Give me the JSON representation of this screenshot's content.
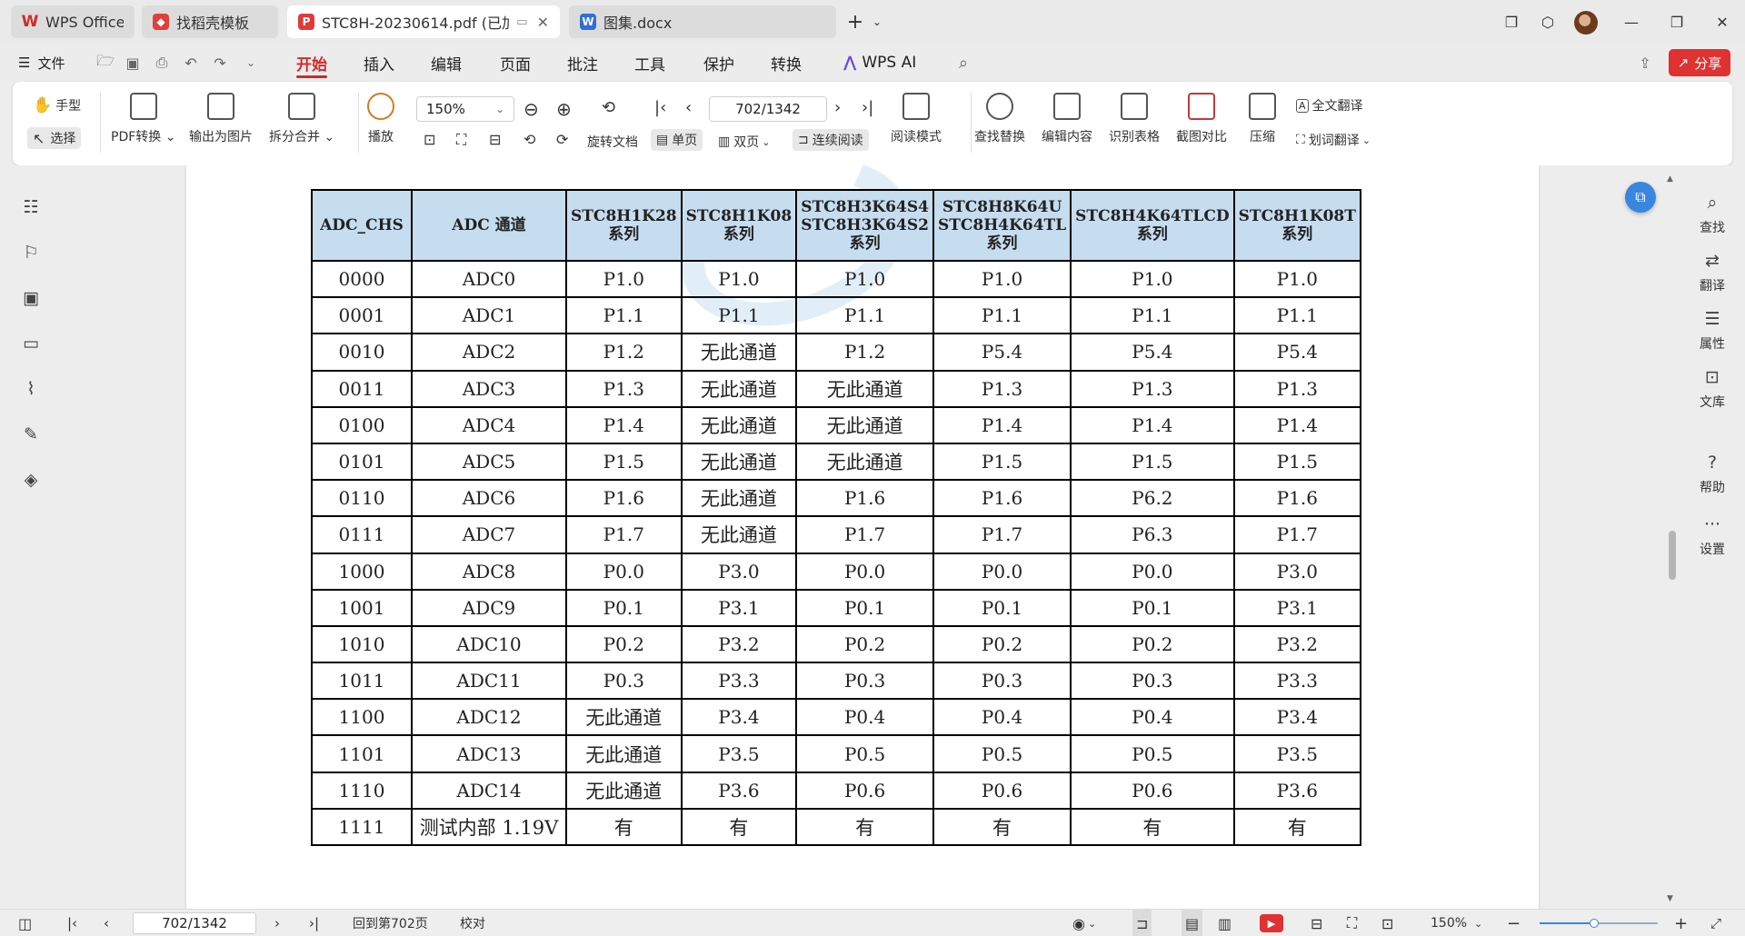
{
  "tabs": [
    {
      "label": "WPS Office",
      "icon": "wps-logo-icon"
    },
    {
      "label": "找稻壳模板",
      "icon": "docer-icon"
    },
    {
      "label": "STC8H-20230614.pdf (已加",
      "icon": "pdf-icon"
    },
    {
      "label": "图集.docx",
      "icon": "word-icon"
    }
  ],
  "menu": {
    "file": "文件",
    "items": [
      "开始",
      "插入",
      "编辑",
      "页面",
      "批注",
      "工具",
      "保护",
      "转换"
    ],
    "wps_ai": "WPS AI",
    "share": "分享"
  },
  "ribbon": {
    "hand": "手型",
    "select": "选择",
    "pdf_convert": "PDF转换",
    "export_image": "输出为图片",
    "split_merge": "拆分合并",
    "play": "播放",
    "zoom": "150%",
    "page": "702/1342",
    "rotate": "旋转文档",
    "single_page": "单页",
    "double_page": "双页",
    "continuous": "连续阅读",
    "read_mode": "阅读模式",
    "find_replace": "查找替换",
    "edit_content": "编辑内容",
    "recognize_table": "识别表格",
    "screenshot_compare": "截图对比",
    "compress": "压缩",
    "full_translate": "全文翻译",
    "word_translate": "划词翻译"
  },
  "right_sidebar": [
    "查找",
    "翻译",
    "属性",
    "文库",
    "帮助",
    "设置"
  ],
  "table": {
    "headers": [
      [
        "ADC_CHS"
      ],
      [
        "ADC 通道"
      ],
      [
        "STC8H1K28",
        "系列"
      ],
      [
        "STC8H1K08",
        "系列"
      ],
      [
        "STC8H3K64S4",
        "STC8H3K64S2",
        "系列"
      ],
      [
        "STC8H8K64U",
        "STC8H4K64TL",
        "系列"
      ],
      [
        "STC8H4K64TLCD",
        "系列"
      ],
      [
        "STC8H1K08T",
        "系列"
      ]
    ],
    "rows": [
      [
        "0000",
        "ADC0",
        "P1.0",
        "P1.0",
        "P1.0",
        "P1.0",
        "P1.0",
        "P1.0"
      ],
      [
        "0001",
        "ADC1",
        "P1.1",
        "P1.1",
        "P1.1",
        "P1.1",
        "P1.1",
        "P1.1"
      ],
      [
        "0010",
        "ADC2",
        "P1.2",
        "无此通道",
        "P1.2",
        "P5.4",
        "P5.4",
        "P5.4"
      ],
      [
        "0011",
        "ADC3",
        "P1.3",
        "无此通道",
        "无此通道",
        "P1.3",
        "P1.3",
        "P1.3"
      ],
      [
        "0100",
        "ADC4",
        "P1.4",
        "无此通道",
        "无此通道",
        "P1.4",
        "P1.4",
        "P1.4"
      ],
      [
        "0101",
        "ADC5",
        "P1.5",
        "无此通道",
        "无此通道",
        "P1.5",
        "P1.5",
        "P1.5"
      ],
      [
        "0110",
        "ADC6",
        "P1.6",
        "无此通道",
        "P1.6",
        "P1.6",
        "P6.2",
        "P1.6"
      ],
      [
        "0111",
        "ADC7",
        "P1.7",
        "无此通道",
        "P1.7",
        "P1.7",
        "P6.3",
        "P1.7"
      ],
      [
        "1000",
        "ADC8",
        "P0.0",
        "P3.0",
        "P0.0",
        "P0.0",
        "P0.0",
        "P3.0"
      ],
      [
        "1001",
        "ADC9",
        "P0.1",
        "P3.1",
        "P0.1",
        "P0.1",
        "P0.1",
        "P3.1"
      ],
      [
        "1010",
        "ADC10",
        "P0.2",
        "P3.2",
        "P0.2",
        "P0.2",
        "P0.2",
        "P3.2"
      ],
      [
        "1011",
        "ADC11",
        "P0.3",
        "P3.3",
        "P0.3",
        "P0.3",
        "P0.3",
        "P3.3"
      ],
      [
        "1100",
        "ADC12",
        "无此通道",
        "P3.4",
        "P0.4",
        "P0.4",
        "P0.4",
        "P3.4"
      ],
      [
        "1101",
        "ADC13",
        "无此通道",
        "P3.5",
        "P0.5",
        "P0.5",
        "P0.5",
        "P3.5"
      ],
      [
        "1110",
        "ADC14",
        "无此通道",
        "P3.6",
        "P0.6",
        "P0.6",
        "P0.6",
        "P3.6"
      ],
      [
        "1111",
        "测试内部 1.19V",
        "有",
        "有",
        "有",
        "有",
        "有",
        "有"
      ]
    ]
  },
  "statusbar": {
    "page": "702/1342",
    "back_to_page": "回到第702页",
    "proofread": "校对",
    "zoom": "150%",
    "zoom_level": 0.46
  },
  "colors": {
    "accent": "#d02a2a",
    "share_bg": "#e03232",
    "header_bg": "#c6dcef",
    "float_btn": "#3a85e0"
  }
}
